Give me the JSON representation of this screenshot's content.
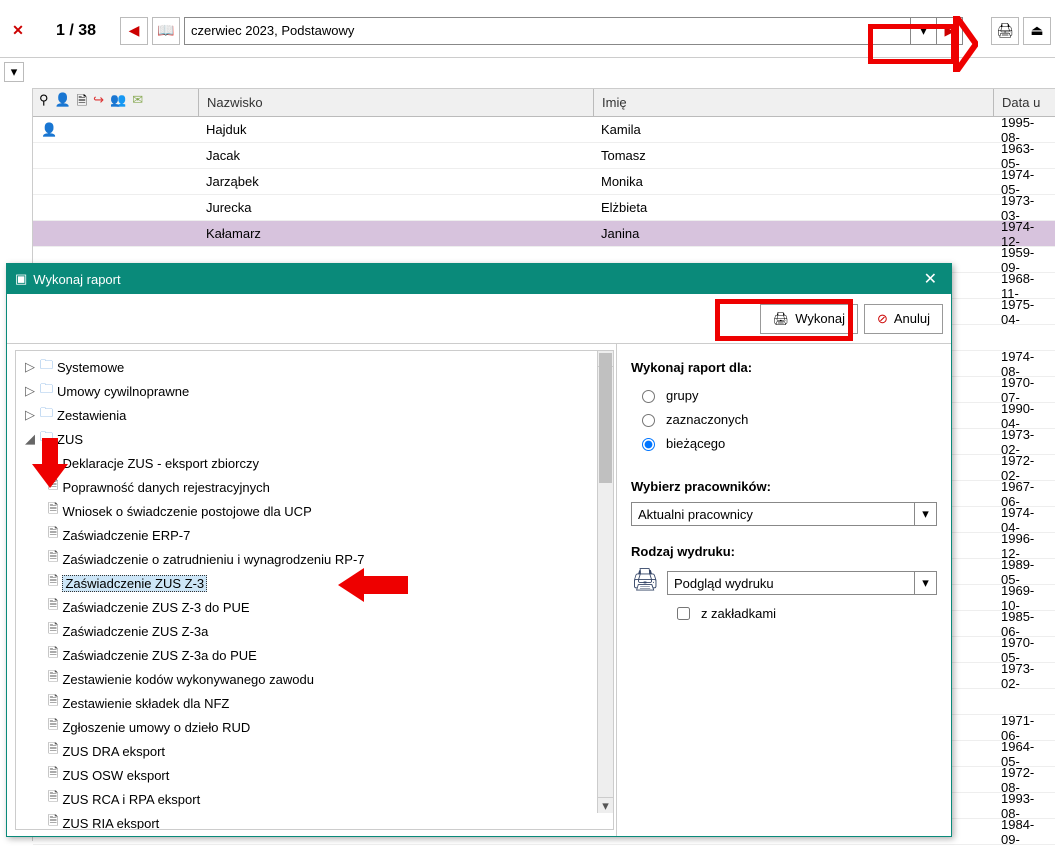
{
  "toolbar": {
    "pager": "1 / 38",
    "combo_value": "czerwiec 2023, Podstawowy"
  },
  "grid": {
    "headers": {
      "nazwisko": "Nazwisko",
      "imie": "Imię",
      "data": "Data u"
    },
    "rows": [
      {
        "nazwisko": "Hajduk",
        "imie": "Kamila",
        "data": "1995-08-",
        "selected": false,
        "icon": true
      },
      {
        "nazwisko": "Jacak",
        "imie": "Tomasz",
        "data": "1963-05-",
        "selected": false
      },
      {
        "nazwisko": "Jarząbek",
        "imie": "Monika",
        "data": "1974-05-",
        "selected": false
      },
      {
        "nazwisko": "Jurecka",
        "imie": "Elżbieta",
        "data": "1973-03-",
        "selected": false
      },
      {
        "nazwisko": "Kałamarz",
        "imie": "Janina",
        "data": "1974-12-",
        "selected": true
      },
      {
        "nazwisko": "",
        "imie": "",
        "data": "1959-09-",
        "selected": false
      },
      {
        "nazwisko": "",
        "imie": "",
        "data": "1968-11-",
        "selected": false
      },
      {
        "nazwisko": "",
        "imie": "",
        "data": "1975-04-",
        "selected": false
      },
      {
        "nazwisko": "",
        "imie": "",
        "data": "",
        "selected": false
      },
      {
        "nazwisko": "",
        "imie": "",
        "data": "1974-08-",
        "selected": false
      },
      {
        "nazwisko": "",
        "imie": "",
        "data": "1970-07-",
        "selected": false
      },
      {
        "nazwisko": "",
        "imie": "",
        "data": "1990-04-",
        "selected": false
      },
      {
        "nazwisko": "",
        "imie": "",
        "data": "1973-02-",
        "selected": false
      },
      {
        "nazwisko": "",
        "imie": "",
        "data": "1972-02-",
        "selected": false
      },
      {
        "nazwisko": "",
        "imie": "",
        "data": "1967-06-",
        "selected": false
      },
      {
        "nazwisko": "",
        "imie": "",
        "data": "1974-04-",
        "selected": false
      },
      {
        "nazwisko": "",
        "imie": "",
        "data": "1996-12-",
        "selected": false
      },
      {
        "nazwisko": "",
        "imie": "",
        "data": "1989-05-",
        "selected": false
      },
      {
        "nazwisko": "",
        "imie": "",
        "data": "1969-10-",
        "selected": false
      },
      {
        "nazwisko": "",
        "imie": "",
        "data": "1985-06-",
        "selected": false
      },
      {
        "nazwisko": "",
        "imie": "",
        "data": "1970-05-",
        "selected": false
      },
      {
        "nazwisko": "",
        "imie": "",
        "data": "1973-02-",
        "selected": false
      },
      {
        "nazwisko": "",
        "imie": "",
        "data": "",
        "selected": false
      },
      {
        "nazwisko": "",
        "imie": "",
        "data": "1971-06-",
        "selected": false
      },
      {
        "nazwisko": "",
        "imie": "",
        "data": "1964-05-",
        "selected": false
      },
      {
        "nazwisko": "",
        "imie": "",
        "data": "1972-08-",
        "selected": false
      },
      {
        "nazwisko": "",
        "imie": "",
        "data": "1993-08-",
        "selected": false
      },
      {
        "nazwisko": "",
        "imie": "",
        "data": "1984-09-",
        "selected": false
      }
    ]
  },
  "dialog": {
    "title": "Wykonaj raport",
    "wykonaj": "Wykonaj",
    "anuluj": "Anuluj",
    "tree_folders": [
      {
        "label": "Systemowe",
        "expanded": false
      },
      {
        "label": "Umowy cywilnoprawne",
        "expanded": false
      },
      {
        "label": "Zestawienia",
        "expanded": false
      },
      {
        "label": "ZUS",
        "expanded": true
      }
    ],
    "tree_zus_items": [
      "Deklaracje ZUS - eksport zbiorczy",
      "Poprawność danych rejestracyjnych",
      "Wniosek o świadczenie postojowe dla UCP",
      "Zaświadczenie ERP-7",
      "Zaświadczenie o zatrudnieniu i wynagrodzeniu RP-7",
      "Zaświadczenie ZUS Z-3",
      "Zaświadczenie ZUS Z-3 do PUE",
      "Zaświadczenie ZUS Z-3a",
      "Zaświadczenie ZUS Z-3a do PUE",
      "Zestawienie kodów wykonywanego zawodu",
      "Zestawienie składek dla NFZ",
      "Zgłoszenie umowy o dzieło RUD",
      "ZUS DRA eksport",
      "ZUS OSW eksport",
      "ZUS RCA i RPA eksport",
      "ZUS RIA eksport"
    ],
    "tree_selected_index": 5,
    "opts": {
      "h1": "Wykonaj raport dla:",
      "r_grupy": "grupy",
      "r_zaznaczonych": "zaznaczonych",
      "r_biezacego": "bieżącego",
      "h2": "Wybierz pracowników:",
      "sel_prac": "Aktualni pracownicy",
      "h3": "Rodzaj wydruku:",
      "sel_wyd": "Podgląd wydruku",
      "chk_zak": "z zakładkami"
    }
  }
}
